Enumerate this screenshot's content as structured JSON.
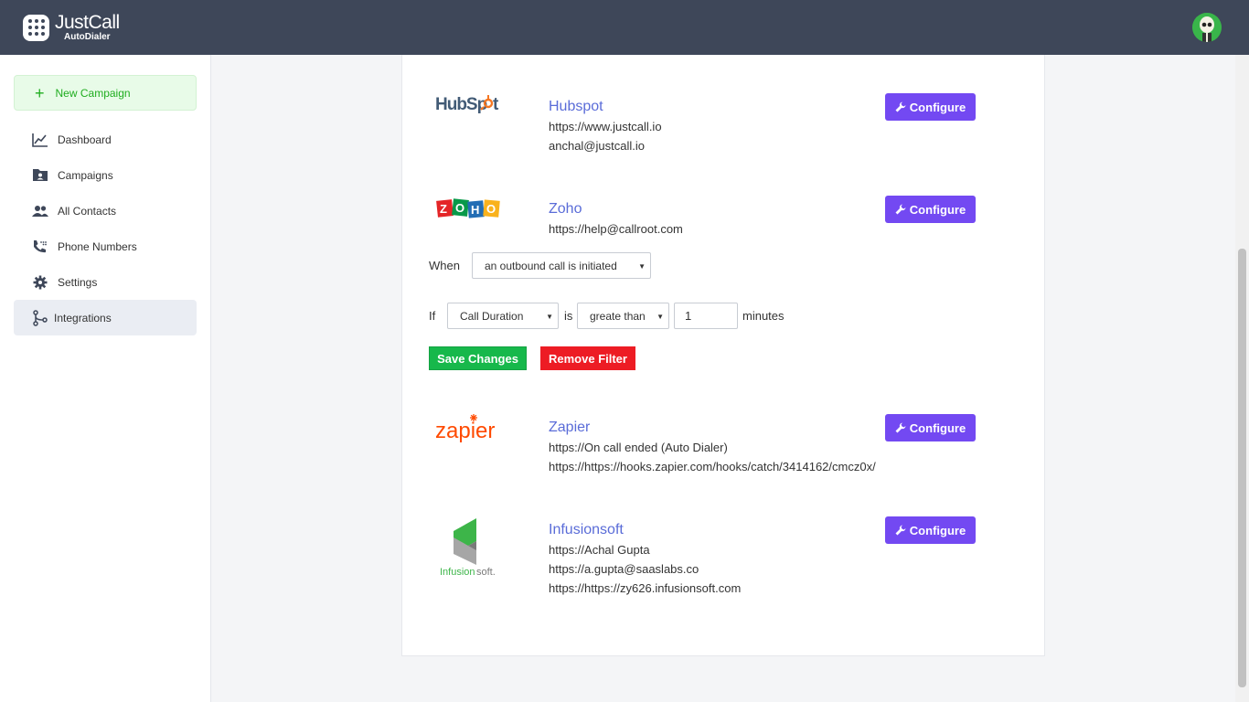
{
  "header": {
    "logo_name": "JustCall",
    "logo_sub": "AutoDialer"
  },
  "sidebar": {
    "new_campaign": "New Campaign",
    "items": [
      {
        "label": "Dashboard",
        "icon": "chart-line-icon"
      },
      {
        "label": "Campaigns",
        "icon": "contact-card-icon"
      },
      {
        "label": "All Contacts",
        "icon": "people-icon"
      },
      {
        "label": "Phone Numbers",
        "icon": "phone-icon"
      },
      {
        "label": "Settings",
        "icon": "gear-icon"
      },
      {
        "label": "Integrations",
        "icon": "integration-icon",
        "active": true
      }
    ]
  },
  "integrations": [
    {
      "name": "Hubspot",
      "logo": "HubSpot",
      "lines": [
        "https://www.justcall.io",
        "anchal@justcall.io"
      ],
      "button": "Configure"
    },
    {
      "name": "Zoho",
      "logo": "ZOHO",
      "lines": [
        "https://help@callroot.com"
      ],
      "button": "Configure"
    },
    {
      "name": "Zapier",
      "logo": "zapier",
      "lines": [
        "https://On call ended (Auto Dialer)",
        "https://https://hooks.zapier.com/hooks/catch/3414162/cmcz0x/"
      ],
      "button": "Configure"
    },
    {
      "name": "Infusionsoft",
      "logo": "Infusionsoft.",
      "lines": [
        "https://Achal Gupta",
        "https://a.gupta@saaslabs.co",
        "https://https://zy626.infusionsoft.com"
      ],
      "button": "Configure"
    }
  ],
  "filter": {
    "when_label": "When",
    "when_value": "an outbound call is initiated",
    "if_label": "If",
    "field_value": "Call Duration",
    "is_label": "is",
    "operator_value": "greate than",
    "amount_value": "1",
    "unit_label": "minutes",
    "save_label": "Save Changes",
    "remove_label": "Remove Filter"
  },
  "colors": {
    "topbar": "#3e4759",
    "configure": "#7349f2",
    "save": "#17b84b",
    "remove": "#ed1c24",
    "link": "#5a6cd8"
  }
}
